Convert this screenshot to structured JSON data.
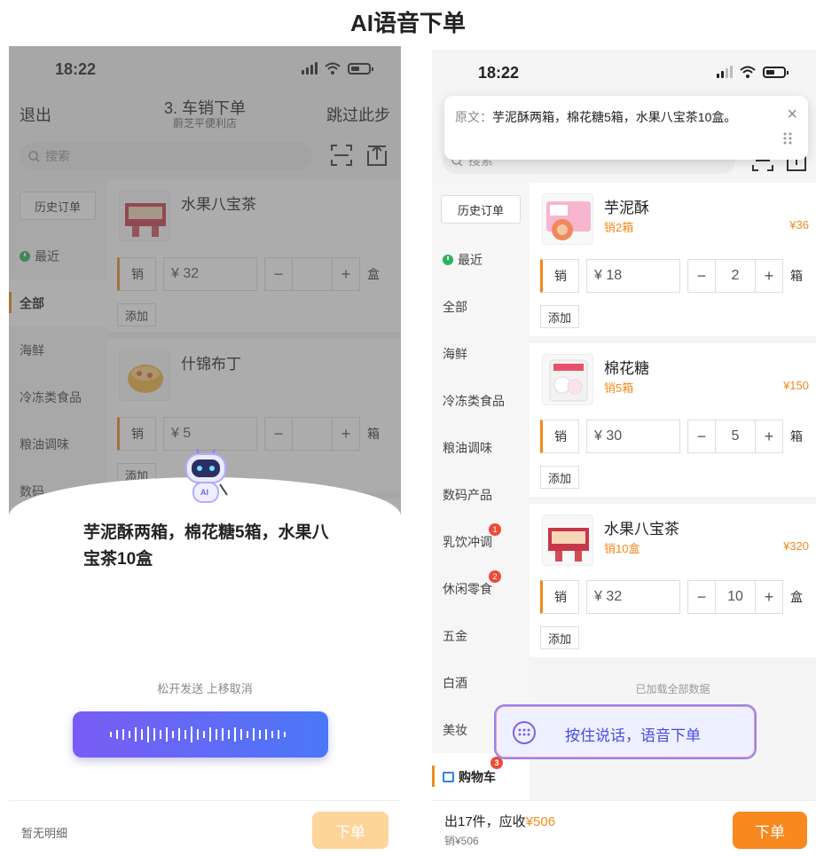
{
  "page_title": "AI语音下单",
  "left": {
    "status_time": "18:22",
    "nav": {
      "back": "退出",
      "title": "3. 车销下单",
      "subtitle": "蔚芝平便利店",
      "skip": "跳过此步"
    },
    "search_placeholder": "搜索",
    "history_label": "历史订单",
    "sidebar": [
      "最近",
      "全部",
      "海鲜",
      "冷冻类食品",
      "粮油调味",
      "数码"
    ],
    "products": [
      {
        "name": "水果八宝茶",
        "sell": "销",
        "price": "¥ 32",
        "minus": "−",
        "plus": "+",
        "unit": "盒",
        "add": "添加"
      },
      {
        "name": "什锦布丁",
        "sell": "销",
        "price": "¥ 5",
        "minus": "−",
        "plus": "+",
        "unit": "箱",
        "add": "添加"
      }
    ],
    "robot_label": "AI",
    "voice_text": "芋泥酥两箱，棉花糖5箱，水果八宝茶10盒",
    "voice_hint": "松开发送 上移取消",
    "footer": {
      "detail": "暂无明细",
      "order": "下单"
    }
  },
  "right": {
    "status_time": "18:22",
    "popup": {
      "label": "原文：",
      "text": "芋泥酥两箱，棉花糖5箱，水果八宝茶10盒。",
      "close": "×"
    },
    "search_placeholder": "搜索",
    "history_label": "历史订单",
    "sidebar": [
      "最近",
      "全部",
      "海鲜",
      "冷冻类食品",
      "粮油调味",
      "数码产品",
      "乳饮冲调",
      "休闲零食",
      "五金",
      "白酒",
      "美妆",
      "购物车"
    ],
    "badges": {
      "dairy": "1",
      "snacks": "2",
      "cart": "3"
    },
    "products": [
      {
        "name": "芋泥酥",
        "sold": "销2箱",
        "total": "¥36",
        "sell": "销",
        "price": "¥ 18",
        "minus": "−",
        "qty": "2",
        "plus": "+",
        "unit": "箱",
        "add": "添加"
      },
      {
        "name": "棉花糖",
        "sold": "销5箱",
        "total": "¥150",
        "sell": "销",
        "price": "¥ 30",
        "minus": "−",
        "qty": "5",
        "plus": "+",
        "unit": "箱",
        "add": "添加"
      },
      {
        "name": "水果八宝茶",
        "sold": "销10盒",
        "total": "¥320",
        "sell": "销",
        "price": "¥ 32",
        "minus": "−",
        "qty": "10",
        "plus": "+",
        "unit": "盒",
        "add": "添加"
      }
    ],
    "loaded_text": "已加载全部数据",
    "talk_label": "按住说话，语音下单",
    "footer": {
      "summary_prefix": "出17件，应收",
      "summary_amount": "¥506",
      "sub": "销¥506",
      "order": "下单"
    }
  }
}
